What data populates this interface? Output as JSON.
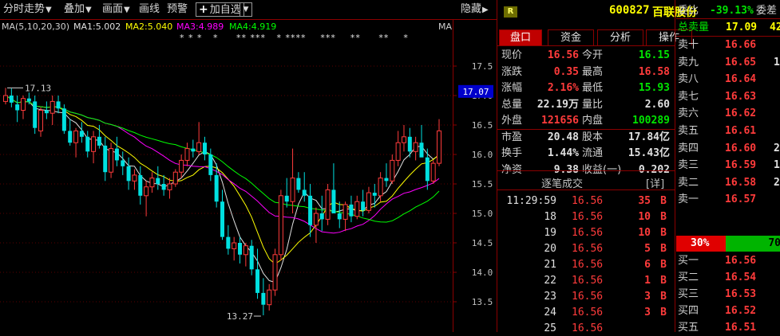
{
  "toolbar": {
    "timeshare": "分时走势",
    "overlay": "叠加",
    "canvas": "画面",
    "draw_line": "画线",
    "alert": "预警",
    "add_watch": "加自选",
    "hide": "隐藏"
  },
  "ma_legend": {
    "ma": "MA(5,10,20,30)",
    "ma1": "MA1:5.002",
    "ma2": "MA2:5.040",
    "ma3": "MA3:4.989",
    "ma4": "MA4:4.919",
    "stars": "* * *   *     ** ***   * ****    ***    **     **    *",
    "right": "MA"
  },
  "colors": {
    "up": "#ff3b3b",
    "down": "#00e0e0",
    "ma1": "#e0e0e0",
    "ma2": "#ffff00",
    "ma3": "#ff00ff",
    "ma4": "#00ff00",
    "border": "#8b0000",
    "current_price_bg": "#0000cc"
  },
  "chart_data": {
    "type": "candlestick",
    "ylim": [
      13.2,
      17.8
    ],
    "y_ticks": [
      "17.5",
      "17.0",
      "16.5",
      "16.0",
      "15.5",
      "15.0",
      "14.5",
      "14.0",
      "13.5"
    ],
    "current_price_label": "17.07",
    "high_annotation": "17.13",
    "low_annotation": "13.27",
    "candles": [
      [
        16.9,
        17.13,
        16.85,
        17.0
      ],
      [
        17.0,
        17.12,
        16.8,
        16.88
      ],
      [
        16.85,
        17.0,
        16.55,
        16.75
      ],
      [
        16.75,
        17.0,
        16.6,
        16.95
      ],
      [
        16.95,
        17.05,
        16.85,
        16.9
      ],
      [
        16.9,
        17.0,
        16.35,
        16.45
      ],
      [
        16.4,
        16.8,
        16.3,
        16.75
      ],
      [
        16.75,
        16.9,
        16.6,
        16.7
      ],
      [
        16.7,
        17.0,
        16.5,
        16.9
      ],
      [
        16.9,
        17.0,
        16.7,
        16.78
      ],
      [
        16.78,
        16.85,
        16.35,
        16.4
      ],
      [
        16.4,
        16.6,
        16.15,
        16.2
      ],
      [
        16.2,
        16.45,
        15.95,
        16.4
      ],
      [
        16.4,
        16.55,
        16.2,
        16.3
      ],
      [
        16.3,
        16.4,
        15.95,
        16.05
      ],
      [
        16.05,
        16.4,
        15.85,
        16.3
      ],
      [
        16.3,
        16.5,
        16.1,
        16.15
      ],
      [
        16.15,
        16.3,
        15.55,
        15.7
      ],
      [
        15.7,
        16.2,
        15.6,
        16.1
      ],
      [
        16.1,
        16.3,
        15.8,
        15.9
      ],
      [
        15.9,
        16.05,
        15.65,
        15.8
      ],
      [
        15.8,
        15.95,
        15.4,
        15.55
      ],
      [
        15.55,
        15.75,
        15.4,
        15.65
      ],
      [
        15.65,
        15.8,
        15.15,
        15.3
      ],
      [
        15.3,
        15.55,
        14.95,
        15.45
      ],
      [
        15.45,
        15.7,
        15.35,
        15.6
      ],
      [
        15.6,
        15.8,
        15.4,
        15.5
      ],
      [
        15.5,
        15.65,
        15.3,
        15.4
      ],
      [
        15.4,
        15.6,
        15.25,
        15.5
      ],
      [
        15.5,
        15.75,
        15.45,
        15.7
      ],
      [
        15.7,
        16.0,
        15.6,
        15.9
      ],
      [
        15.9,
        16.2,
        15.8,
        16.1
      ],
      [
        16.1,
        16.25,
        15.95,
        16.05
      ],
      [
        16.05,
        16.55,
        16.0,
        16.2
      ],
      [
        16.2,
        16.3,
        15.9,
        16.0
      ],
      [
        16.0,
        16.1,
        15.55,
        15.65
      ],
      [
        15.65,
        15.85,
        15.1,
        15.2
      ],
      [
        15.2,
        15.4,
        14.55,
        14.6
      ],
      [
        14.6,
        14.8,
        14.3,
        14.4
      ],
      [
        14.4,
        14.6,
        14.2,
        14.5
      ],
      [
        14.5,
        14.6,
        14.15,
        14.3
      ],
      [
        14.3,
        14.5,
        14.1,
        14.45
      ],
      [
        14.45,
        14.55,
        13.95,
        14.05
      ],
      [
        14.05,
        14.4,
        13.55,
        13.65
      ],
      [
        13.65,
        13.9,
        13.27,
        13.45
      ],
      [
        13.45,
        13.8,
        13.35,
        13.7
      ],
      [
        13.7,
        14.4,
        13.6,
        14.3
      ],
      [
        14.3,
        15.4,
        14.2,
        15.3
      ],
      [
        15.3,
        15.6,
        15.1,
        15.2
      ],
      [
        15.2,
        16.1,
        15.0,
        15.6
      ],
      [
        15.6,
        15.7,
        15.35,
        15.4
      ],
      [
        15.4,
        15.7,
        15.2,
        15.3
      ],
      [
        15.3,
        15.5,
        14.6,
        14.8
      ],
      [
        14.8,
        15.1,
        14.5,
        15.0
      ],
      [
        15.0,
        15.3,
        14.7,
        14.9
      ],
      [
        14.9,
        15.5,
        14.8,
        15.4
      ],
      [
        15.4,
        15.85,
        15.3,
        15.0
      ],
      [
        15.0,
        15.2,
        14.75,
        14.9
      ],
      [
        14.9,
        15.2,
        14.7,
        15.15
      ],
      [
        15.15,
        15.3,
        14.85,
        14.95
      ],
      [
        14.95,
        15.3,
        14.9,
        15.2
      ],
      [
        15.2,
        15.4,
        14.95,
        15.05
      ],
      [
        15.05,
        15.45,
        15.0,
        15.35
      ],
      [
        15.35,
        15.5,
        15.1,
        15.3
      ],
      [
        15.3,
        15.7,
        15.2,
        15.6
      ],
      [
        15.6,
        15.85,
        15.45,
        15.55
      ],
      [
        15.55,
        16.0,
        15.5,
        15.9
      ],
      [
        15.9,
        16.4,
        15.8,
        16.2
      ],
      [
        16.2,
        16.5,
        16.05,
        16.3
      ],
      [
        16.3,
        16.45,
        15.95,
        16.05
      ],
      [
        16.05,
        16.3,
        15.9,
        16.2
      ],
      [
        16.2,
        16.5,
        16.0,
        15.95
      ],
      [
        15.95,
        16.1,
        15.4,
        15.55
      ],
      [
        15.55,
        15.9,
        15.5,
        15.85
      ],
      [
        15.85,
        16.6,
        15.8,
        16.4
      ]
    ]
  },
  "stock": {
    "badge": "R",
    "code": "600827",
    "name": "百联股份"
  },
  "tabs": [
    "盘口",
    "资金",
    "分析",
    "操作"
  ],
  "quote": {
    "rows": [
      {
        "l1": "现价",
        "v1": "16.56",
        "c1": "red",
        "l2": "今开",
        "v2": "16.15",
        "c2": "green"
      },
      {
        "l1": "涨跌",
        "v1": "0.35",
        "c1": "red",
        "l2": "最高",
        "v2": "16.58",
        "c2": "red"
      },
      {
        "l1": "涨幅",
        "v1": "2.16%",
        "c1": "red",
        "l2": "最低",
        "v2": "15.93",
        "c2": "green"
      },
      {
        "l1": "总量",
        "v1": "22.19万",
        "c1": "white",
        "l2": "量比",
        "v2": "2.60",
        "c2": "white"
      },
      {
        "l1": "外盘",
        "v1": "121656",
        "c1": "red",
        "l2": "内盘",
        "v2": "100289",
        "c2": "green"
      },
      {
        "l1": "市盈",
        "v1": "20.48",
        "c1": "white",
        "l2": "股本",
        "v2": "17.84亿",
        "c2": "white"
      },
      {
        "l1": "换手",
        "v1": "1.44%",
        "c1": "white",
        "l2": "流通",
        "v2": "15.43亿",
        "c2": "white"
      },
      {
        "l1": "净资",
        "v1": "9.38",
        "c1": "white",
        "l2": "收益(一)",
        "v2": "0.202",
        "c2": "white"
      }
    ]
  },
  "trades": {
    "title": "逐笔成交",
    "detail": "[详]",
    "rows": [
      {
        "time": "11:29:59",
        "price": "16.56",
        "vol": "35",
        "dir": "B"
      },
      {
        "time": "18",
        "price": "16.56",
        "vol": "10",
        "dir": "B"
      },
      {
        "time": "19",
        "price": "16.56",
        "vol": "10",
        "dir": "B"
      },
      {
        "time": "20",
        "price": "16.56",
        "vol": "5",
        "dir": "B"
      },
      {
        "time": "21",
        "price": "16.56",
        "vol": "6",
        "dir": "B"
      },
      {
        "time": "22",
        "price": "16.56",
        "vol": "1",
        "dir": "B"
      },
      {
        "time": "23",
        "price": "16.56",
        "vol": "3",
        "dir": "B"
      },
      {
        "time": "24",
        "price": "16.56",
        "vol": "3",
        "dir": "B"
      },
      {
        "time": "25",
        "price": "16.56",
        "vol": "",
        "dir": ""
      }
    ]
  },
  "order_book": {
    "weibi_label": "委比",
    "weibi_value": "-39.13%",
    "weicha_label": "委差",
    "total_sell_label": "总卖量",
    "total_sell_value": "17.09",
    "total_sell_extra": "42",
    "asks": [
      {
        "label": "卖十",
        "price": "16.66",
        "vol": ""
      },
      {
        "label": "卖九",
        "price": "16.65",
        "vol": "1"
      },
      {
        "label": "卖八",
        "price": "16.64",
        "vol": ""
      },
      {
        "label": "卖七",
        "price": "16.63",
        "vol": ""
      },
      {
        "label": "卖六",
        "price": "16.62",
        "vol": ""
      },
      {
        "label": "卖五",
        "price": "16.61",
        "vol": ""
      },
      {
        "label": "卖四",
        "price": "16.60",
        "vol": "2"
      },
      {
        "label": "卖三",
        "price": "16.59",
        "vol": "1"
      },
      {
        "label": "卖二",
        "price": "16.58",
        "vol": "2"
      },
      {
        "label": "卖一",
        "price": "16.57",
        "vol": ""
      }
    ],
    "ratio_sell": "30%",
    "ratio_buy": "70",
    "ratio_sell_fraction": 0.3,
    "bids": [
      {
        "label": "买一",
        "price": "16.56"
      },
      {
        "label": "买二",
        "price": "16.54"
      },
      {
        "label": "买三",
        "price": "16.53"
      },
      {
        "label": "买四",
        "price": "16.52"
      },
      {
        "label": "买五",
        "price": "16.51"
      }
    ]
  }
}
